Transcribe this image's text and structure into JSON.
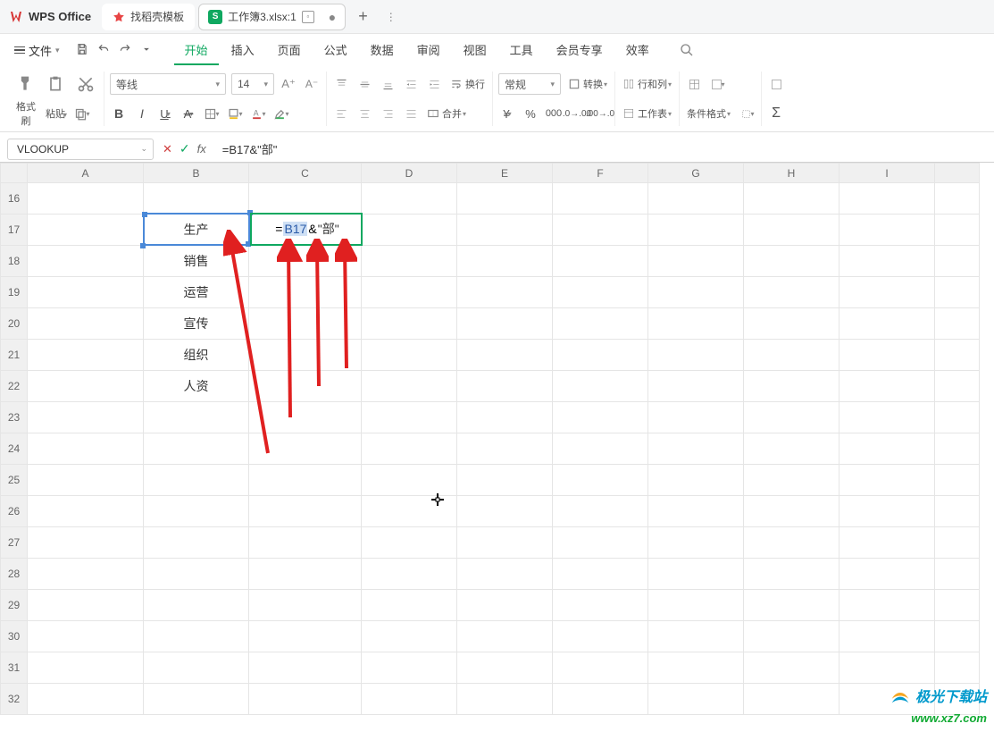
{
  "titlebar": {
    "app_name": "WPS Office",
    "template_tab": "找稻壳模板",
    "workbook_tab": "工作簿3.xlsx:1",
    "spread_badge": "S",
    "add": "+",
    "menu": "⋮"
  },
  "menubar": {
    "file": "文件",
    "tabs": [
      "开始",
      "插入",
      "页面",
      "公式",
      "数据",
      "审阅",
      "视图",
      "工具",
      "会员专享",
      "效率"
    ],
    "active_index": 0
  },
  "ribbon": {
    "format_painter": "格式刷",
    "paste": "粘贴",
    "font_name": "等线",
    "font_size": "14",
    "number_format": "常规",
    "convert": "转换",
    "rows_cols": "行和列",
    "worksheet": "工作表",
    "cond_format": "条件格式",
    "wrap": "换行",
    "merge": "合并"
  },
  "formula_bar": {
    "name_box": "VLOOKUP",
    "formula": "=B17&\"部\"",
    "fx": "fx"
  },
  "grid": {
    "columns": [
      "A",
      "B",
      "C",
      "D",
      "E",
      "F",
      "G",
      "H",
      "I",
      ""
    ],
    "rows": [
      16,
      17,
      18,
      19,
      20,
      21,
      22,
      23,
      24,
      25,
      26,
      27,
      28,
      29,
      30,
      31,
      32
    ],
    "cells_B": [
      "",
      "生产",
      "销售",
      "运营",
      "宣传",
      "组织",
      "人资",
      "",
      "",
      "",
      "",
      "",
      "",
      "",
      "",
      "",
      ""
    ],
    "c17_eq": "=",
    "c17_ref": "B17",
    "c17_amp": "&",
    "c17_str": "\"部\""
  },
  "watermark": {
    "zh": "极光下载站",
    "url": "www.xz7.com"
  }
}
